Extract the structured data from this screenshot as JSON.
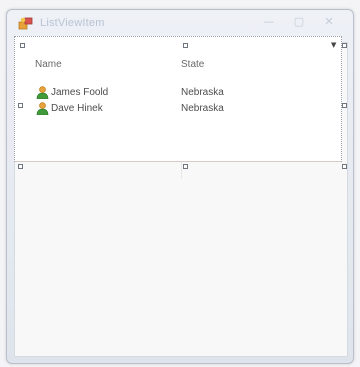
{
  "window": {
    "title": "ListViewItem"
  },
  "caption_buttons": {
    "minimize_glyph": "—",
    "maximize_glyph": "▢",
    "close_glyph": "✕"
  },
  "listview": {
    "columns": [
      "Name",
      "State"
    ],
    "rows": [
      {
        "name": "James Foold",
        "state": "Nebraska",
        "icon": "person-icon"
      },
      {
        "name": "Dave Hinek",
        "state": "Nebraska",
        "icon": "person-icon"
      }
    ]
  },
  "smart_tag_glyph": "▼",
  "colors": {
    "icon_orange": "#e8a23a",
    "icon_green": "#3f9a3a"
  }
}
